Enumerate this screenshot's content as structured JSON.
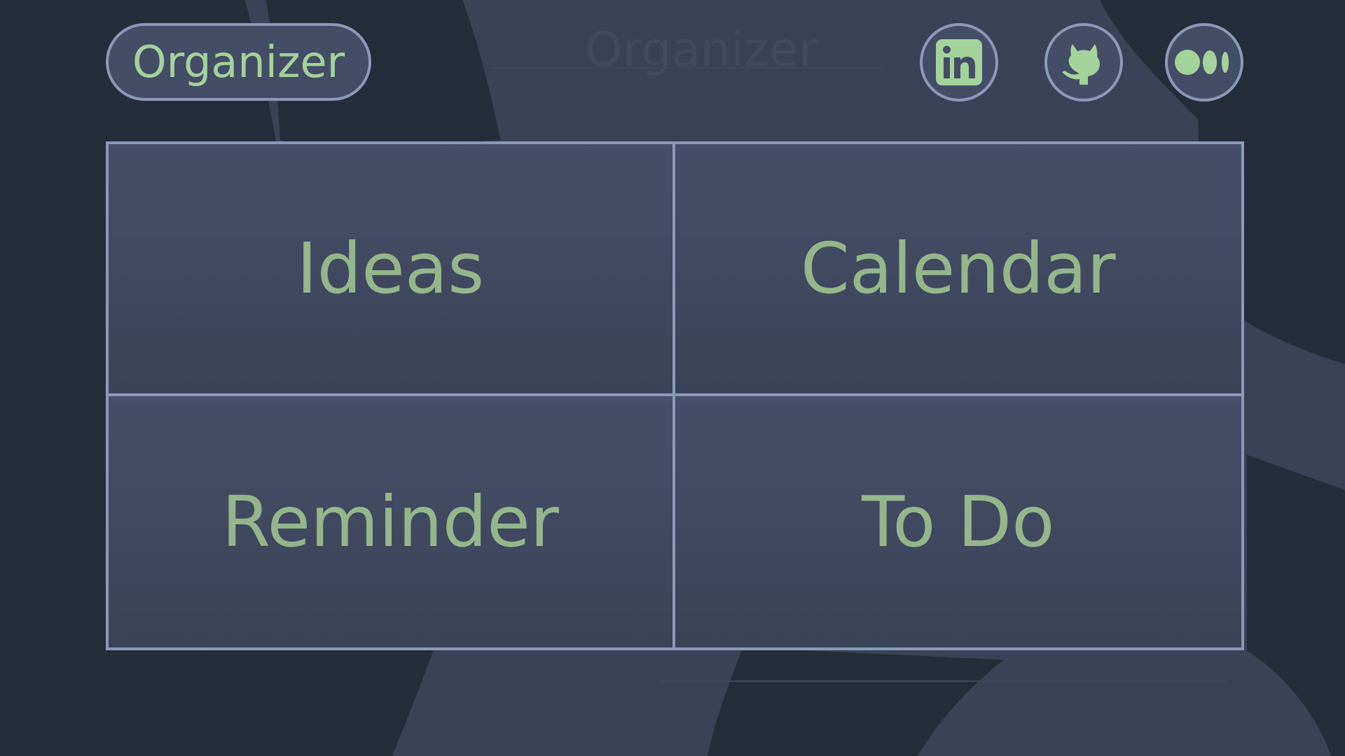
{
  "header": {
    "brand_label": "Organizer",
    "ghost_title": "Organizer",
    "social_links": [
      {
        "name": "linkedin",
        "icon": "linkedin-icon"
      },
      {
        "name": "github",
        "icon": "github-icon"
      },
      {
        "name": "medium",
        "icon": "medium-icon"
      }
    ]
  },
  "tiles": [
    {
      "label": "Ideas"
    },
    {
      "label": "Calendar"
    },
    {
      "label": "Reminder"
    },
    {
      "label": "To Do"
    }
  ],
  "colors": {
    "background": "#394256",
    "background_blob": "#252c3a",
    "panel": "#434d65",
    "border": "#8b99bb",
    "accent_text": "#a4d29b",
    "tile_text": "#94b68b"
  }
}
